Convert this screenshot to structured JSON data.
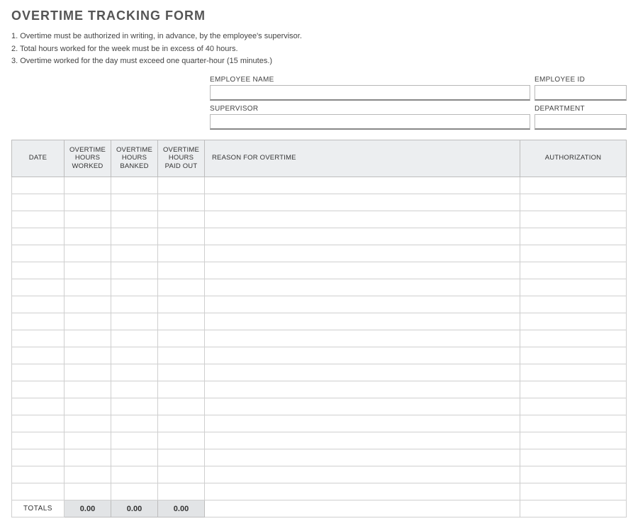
{
  "title": "OVERTIME TRACKING FORM",
  "rules": [
    "1. Overtime must be authorized in writing, in advance, by the employee's supervisor.",
    "2. Total hours worked for the week must be in excess of 40 hours.",
    "3. Overtime worked for the day must exceed one quarter-hour (15 minutes.)"
  ],
  "employee_fields": {
    "name_label": "EMPLOYEE NAME",
    "name_value": "",
    "id_label": "EMPLOYEE ID",
    "id_value": "",
    "supervisor_label": "SUPERVISOR",
    "supervisor_value": "",
    "department_label": "DEPARTMENT",
    "department_value": ""
  },
  "table": {
    "headers": {
      "date": "DATE",
      "hours_worked": "OVERTIME HOURS WORKED",
      "hours_banked": "OVERTIME HOURS BANKED",
      "hours_paid": "OVERTIME HOURS PAID OUT",
      "reason": "REASON FOR OVERTIME",
      "authorization": "AUTHORIZATION"
    },
    "row_count": 19,
    "totals_label": "TOTALS",
    "totals": {
      "worked": "0.00",
      "banked": "0.00",
      "paid": "0.00"
    }
  }
}
